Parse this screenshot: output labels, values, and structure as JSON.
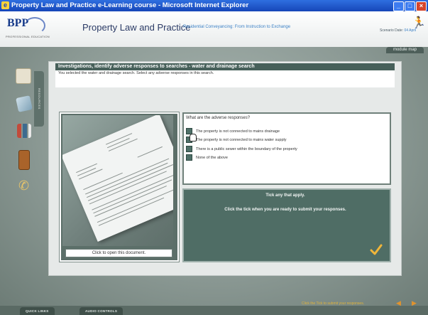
{
  "window": {
    "title": "Property Law and Practice e-Learning course - Microsoft Internet Explorer"
  },
  "header": {
    "logo_text": "BPP",
    "logo_tagline": "PROFESSIONAL EDUCATION",
    "title": "Property Law and Practice",
    "subtitle": "Residential Conveyancing: From Instruction to Exchange",
    "scenario_label": "Scenario Date:",
    "scenario_value": "04 April",
    "module_map": "module map"
  },
  "sidebar": {
    "tab_label": "RESOURCES",
    "icons": [
      "folder-icon",
      "stack-icon",
      "figures-icon",
      "book-icon",
      "phone-icon"
    ]
  },
  "instruction": {
    "title": "Investigations, identify adverse responses to searches - water and drainage search",
    "body": "You selected the water and drainage search. Select any adverse responses in this search."
  },
  "document": {
    "open_label": "Click to open this document."
  },
  "question": {
    "prompt": "What are the adverse responses?",
    "options": [
      "The property is not connected to mains drainage",
      "The property is not connected to mains water supply",
      "There is a public sewer within the boundary of the property",
      "None of the above"
    ]
  },
  "feedback": {
    "line1": "Tick any that apply.",
    "line2": "Click the tick when you are ready to submit your responses."
  },
  "footer": {
    "quick_links": "QUICK LINKS",
    "audio_controls": "AUDIO CONTROLS",
    "submit_hint": "Click the Tick to submit your responses."
  },
  "colors": {
    "accent_teal": "#4f6d65",
    "title_bar": "#1646b8",
    "tick": "#f0b63a",
    "subtitle_blue": "#3e82c6"
  }
}
